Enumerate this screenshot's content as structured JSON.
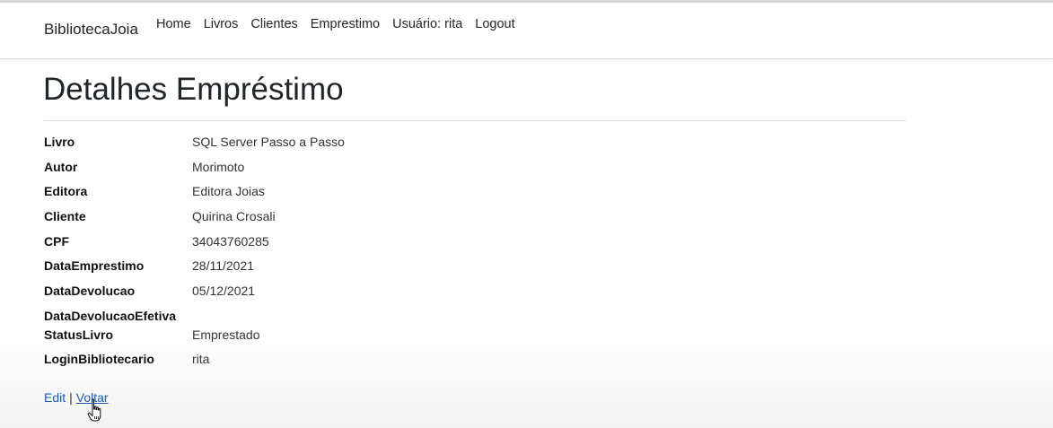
{
  "navbar": {
    "brand": "BibliotecaJoia",
    "items": [
      {
        "label": "Home"
      },
      {
        "label": "Livros"
      },
      {
        "label": "Clientes"
      },
      {
        "label": "Emprestimo"
      },
      {
        "label": "Usuário: rita"
      },
      {
        "label": "Logout"
      }
    ]
  },
  "page": {
    "title": "Detalhes Empréstimo"
  },
  "details": [
    {
      "label": "Livro",
      "value": "SQL Server Passo a Passo"
    },
    {
      "label": "Autor",
      "value": "Morimoto"
    },
    {
      "label": "Editora",
      "value": "Editora Joias"
    },
    {
      "label": "Cliente",
      "value": "Quirina Crosali"
    },
    {
      "label": "CPF",
      "value": "34043760285"
    },
    {
      "label": "DataEmprestimo",
      "value": "28/11/2021"
    },
    {
      "label": "DataDevolucao",
      "value": "05/12/2021"
    },
    {
      "label": "DataDevolucaoEfetiva",
      "value": ""
    },
    {
      "label": "StatusLivro",
      "value": "Emprestado"
    },
    {
      "label": "LoginBibliotecario",
      "value": "rita"
    }
  ],
  "actions": {
    "edit_label": "Edit",
    "separator": "|",
    "back_label": "Voltar"
  },
  "colors": {
    "link": "#1a5db4",
    "text": "#212529"
  }
}
